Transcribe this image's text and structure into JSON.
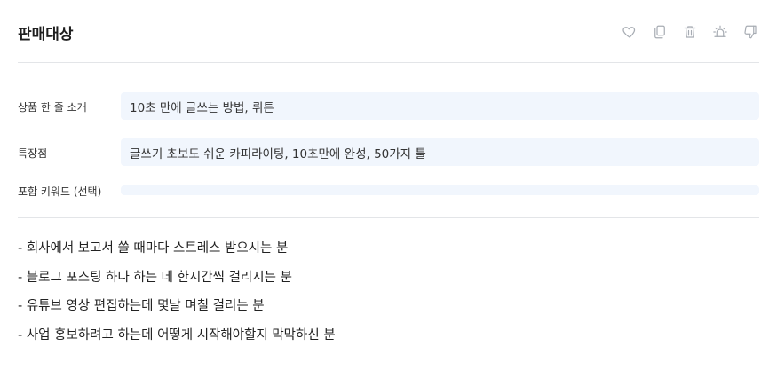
{
  "header": {
    "title": "판매대상",
    "actions": [
      {
        "icon": "heart-icon"
      },
      {
        "icon": "copy-icon"
      },
      {
        "icon": "trash-icon"
      },
      {
        "icon": "alarm-icon"
      },
      {
        "icon": "thumbs-down-icon"
      }
    ]
  },
  "form": {
    "product_intro": {
      "label": "상품 한 줄 소개",
      "value": "10초 만에 글쓰는 방법, 뤼튼"
    },
    "features": {
      "label": "특장점",
      "value": "글쓰기 초보도 쉬운 카피라이팅, 10초만에 완성, 50가지 툴"
    },
    "keywords": {
      "label": "포함 키워드 (선택)",
      "value": ""
    }
  },
  "result": {
    "items": [
      "- 회사에서 보고서 쓸 때마다 스트레스 받으시는 분",
      "- 블로그 포스팅 하나 하는 데 한시간씩 걸리시는 분",
      "- 유튜브 영상 편집하는데 몇날 며칠 걸리는 분",
      "- 사업 홍보하려고 하는데 어떻게 시작해야할지 막막하신 분"
    ]
  }
}
